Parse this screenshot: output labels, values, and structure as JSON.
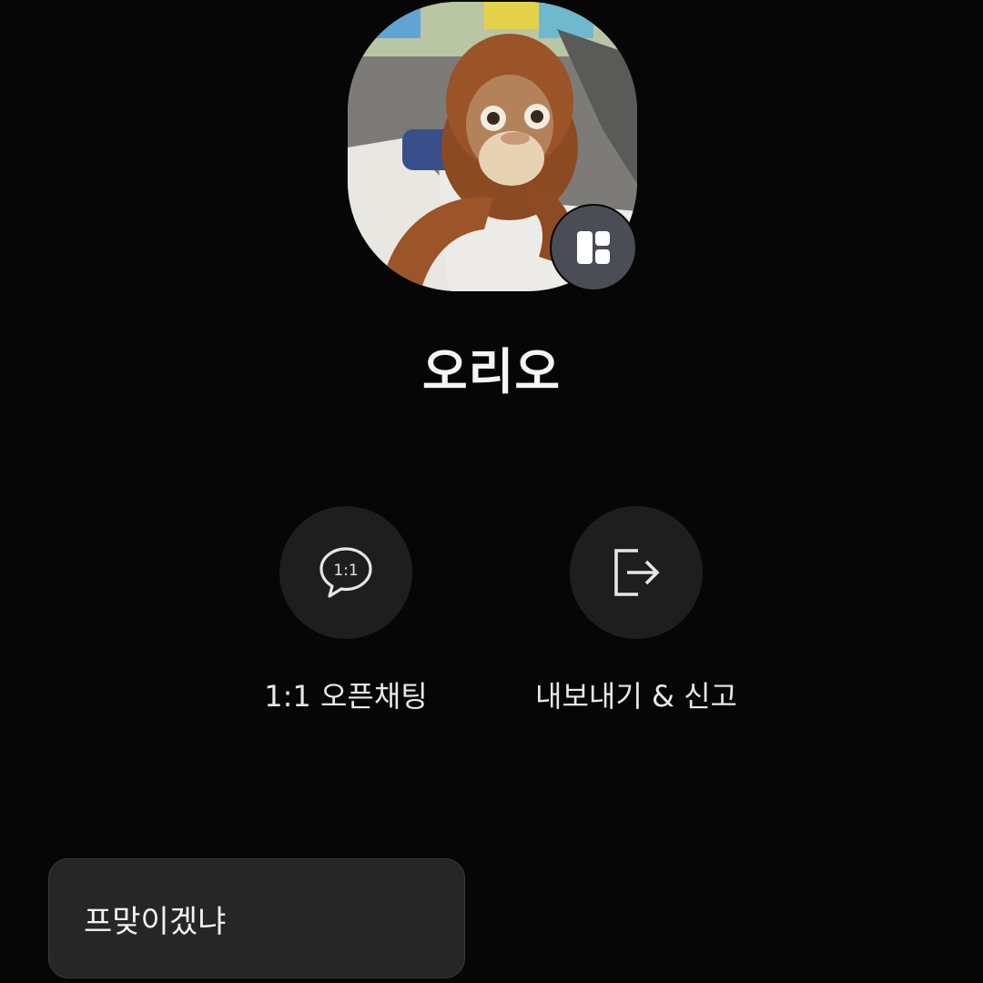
{
  "profile": {
    "name": "오리오",
    "avatar_icon": "profile-photo",
    "badge_icon": "open-profile-icon"
  },
  "actions": [
    {
      "label": "1:1 오픈채팅",
      "icon": "chat-bubble-1to1-icon",
      "icon_text": "1:1"
    },
    {
      "label": "내보내기 & 신고",
      "icon": "exit-arrow-icon"
    }
  ],
  "toast": {
    "text": "프맞이겠냐"
  },
  "colors": {
    "background": "#060606",
    "action_circle": "#1e1e1e",
    "badge": "#4a4d55",
    "toast_bg": "#262626"
  }
}
